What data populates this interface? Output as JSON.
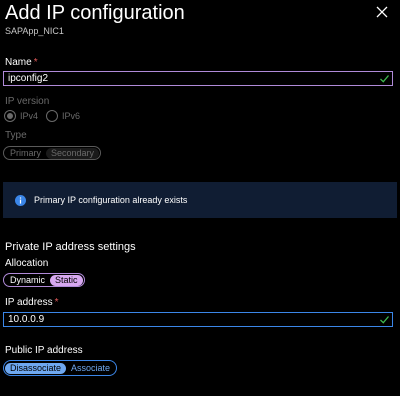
{
  "header": {
    "title": "Add IP configuration",
    "subtitle": "SAPApp_NIC1"
  },
  "name_field": {
    "label": "Name",
    "required_mark": "*",
    "value": "ipconfig2"
  },
  "ip_version": {
    "label": "IP version",
    "options": [
      "IPv4",
      "IPv6"
    ],
    "selected": "IPv4"
  },
  "type": {
    "label": "Type",
    "options": [
      "Primary",
      "Secondary"
    ],
    "selected": "Secondary"
  },
  "info": {
    "message": "Primary IP configuration already exists"
  },
  "private_ip": {
    "section_title": "Private IP address settings",
    "allocation_label": "Allocation",
    "allocation_options": [
      "Dynamic",
      "Static"
    ],
    "allocation_selected": "Static",
    "ip_label": "IP address",
    "ip_required_mark": "*",
    "ip_value": "10.0.0.9"
  },
  "public_ip": {
    "label": "Public IP address",
    "options": [
      "Disassociate",
      "Associate"
    ],
    "selected": "Disassociate"
  },
  "colors": {
    "background": "#000000",
    "accent_purple": "#b08ad8",
    "accent_blue": "#3b86e8",
    "success_green": "#3fb950",
    "info_bg": "#101d33"
  }
}
